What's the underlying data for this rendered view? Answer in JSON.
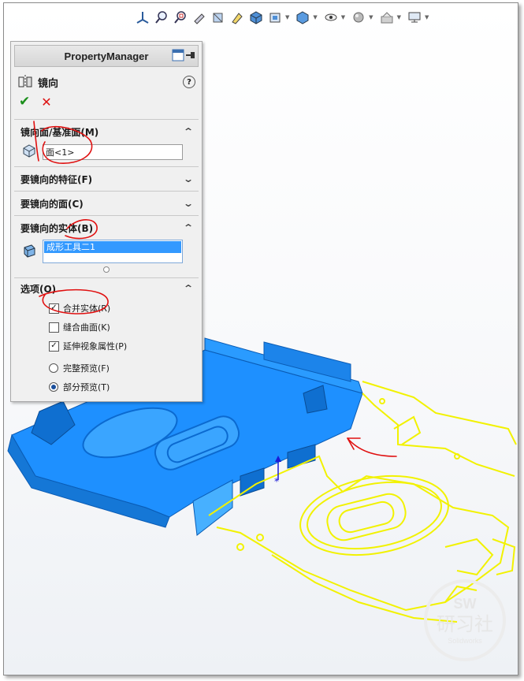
{
  "property_manager": {
    "title": "PropertyManager",
    "command": {
      "title": "镜向"
    },
    "sections": {
      "mirror_face": {
        "title": "镜向面/基准面(M)",
        "value": "面<1>"
      },
      "features": {
        "title": "要镜向的特征(F)"
      },
      "faces": {
        "title": "要镜向的面(C)"
      },
      "bodies": {
        "title": "要镜向的实体(B)",
        "items": [
          "成形工具二1"
        ]
      },
      "options": {
        "title": "选项(O)",
        "merge_solids": {
          "label": "合并实体(R)",
          "checked": true
        },
        "knit_surfaces": {
          "label": "缝合曲面(K)",
          "checked": false
        },
        "propagate_visual": {
          "label": "延伸视象属性(P)",
          "checked": true
        },
        "full_preview": {
          "label": "完整预览(F)",
          "selected": false
        },
        "partial_preview": {
          "label": "部分预览(T)",
          "selected": true
        }
      }
    }
  },
  "toolbar": {
    "icons": [
      "view-orientation-icon",
      "zoom-fit-icon",
      "zoom-area-icon",
      "previous-view-icon",
      "section-view-icon",
      "dynamic-annotation-icon",
      "view-cube-icon",
      "view-settings-icon",
      "display-style-icon",
      "hide-show-icon",
      "edit-appearance-icon",
      "apply-scene-icon",
      "monitor-icon"
    ]
  },
  "watermark": {
    "line1": "SW",
    "line2": "研习社",
    "line3": "Solidworks"
  },
  "colors": {
    "body_blue": "#1e90ff",
    "preview_yellow": "#f7f700",
    "annotation_red": "#e01010",
    "selection_blue": "#3399ff"
  }
}
